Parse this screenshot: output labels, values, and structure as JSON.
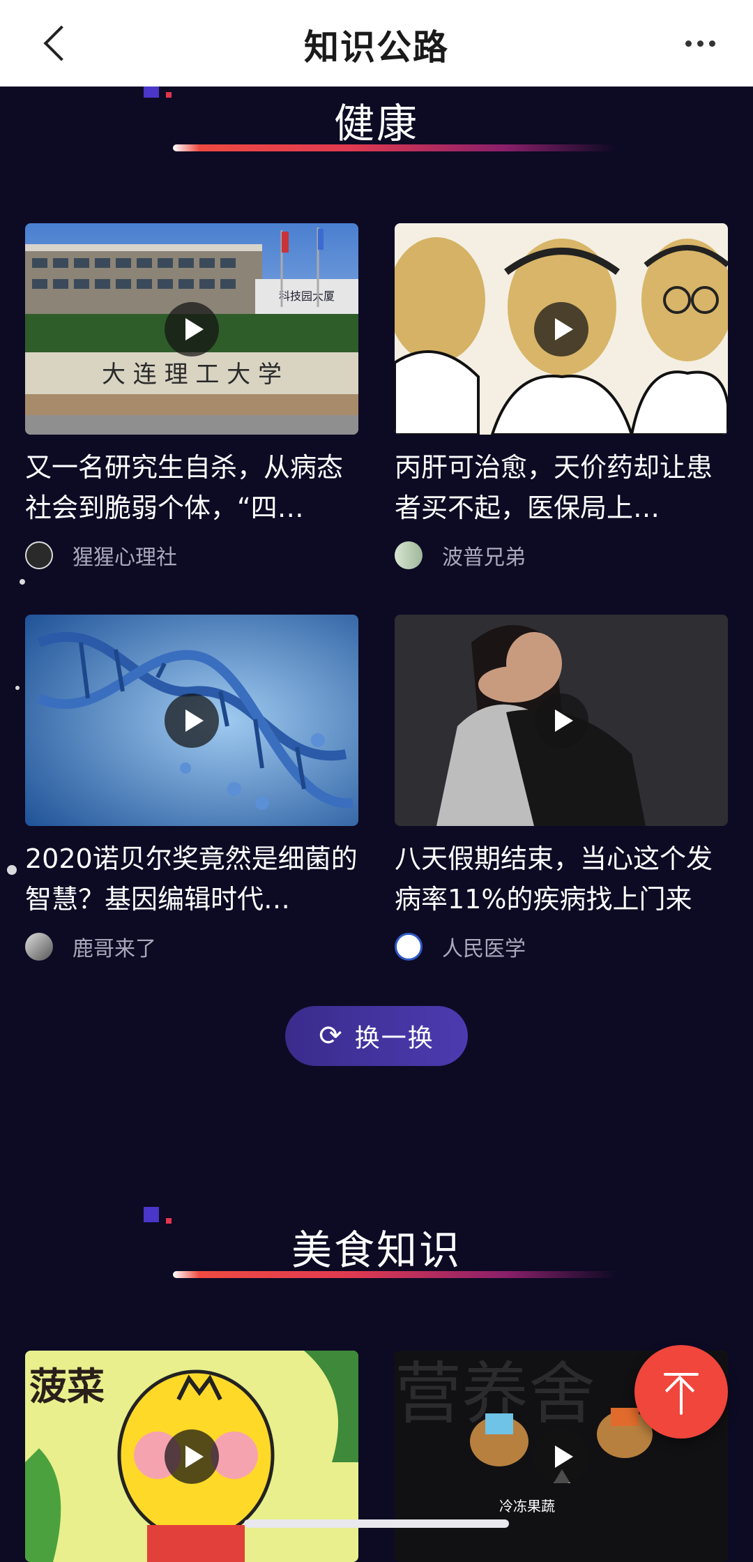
{
  "header": {
    "title": "知识公路"
  },
  "sections": [
    {
      "title": "健康",
      "cards": [
        {
          "title": "又一名研究生自杀，从病态社会到脆弱个体，“四…",
          "author": "猩猩心理社"
        },
        {
          "title": "丙肝可治愈，天价药却让患者买不起，医保局上…",
          "author": "波普兄弟"
        },
        {
          "title": "2020诺贝尔奖竟然是细菌的智慧？基因编辑时代…",
          "author": "鹿哥来了"
        },
        {
          "title": "八天假期结束，当心这个发病率11%的疾病找上门来",
          "author": "人民医学"
        }
      ],
      "refresh_label": "换一换"
    },
    {
      "title": "美食知识",
      "cards": [
        {
          "thumb_text": "菠菜"
        },
        {
          "thumb_text": "冷冻果蔬",
          "thumb_bg_text": "营养舍"
        }
      ]
    }
  ],
  "thumb_texts": {
    "campus_sign": "大 连 理 工 大 学",
    "building_sign": "科技园大厦"
  },
  "colors": {
    "page_bg": "#0d0a24",
    "accent_red": "#f0463c",
    "accent_purple": "#4c3bb0"
  }
}
